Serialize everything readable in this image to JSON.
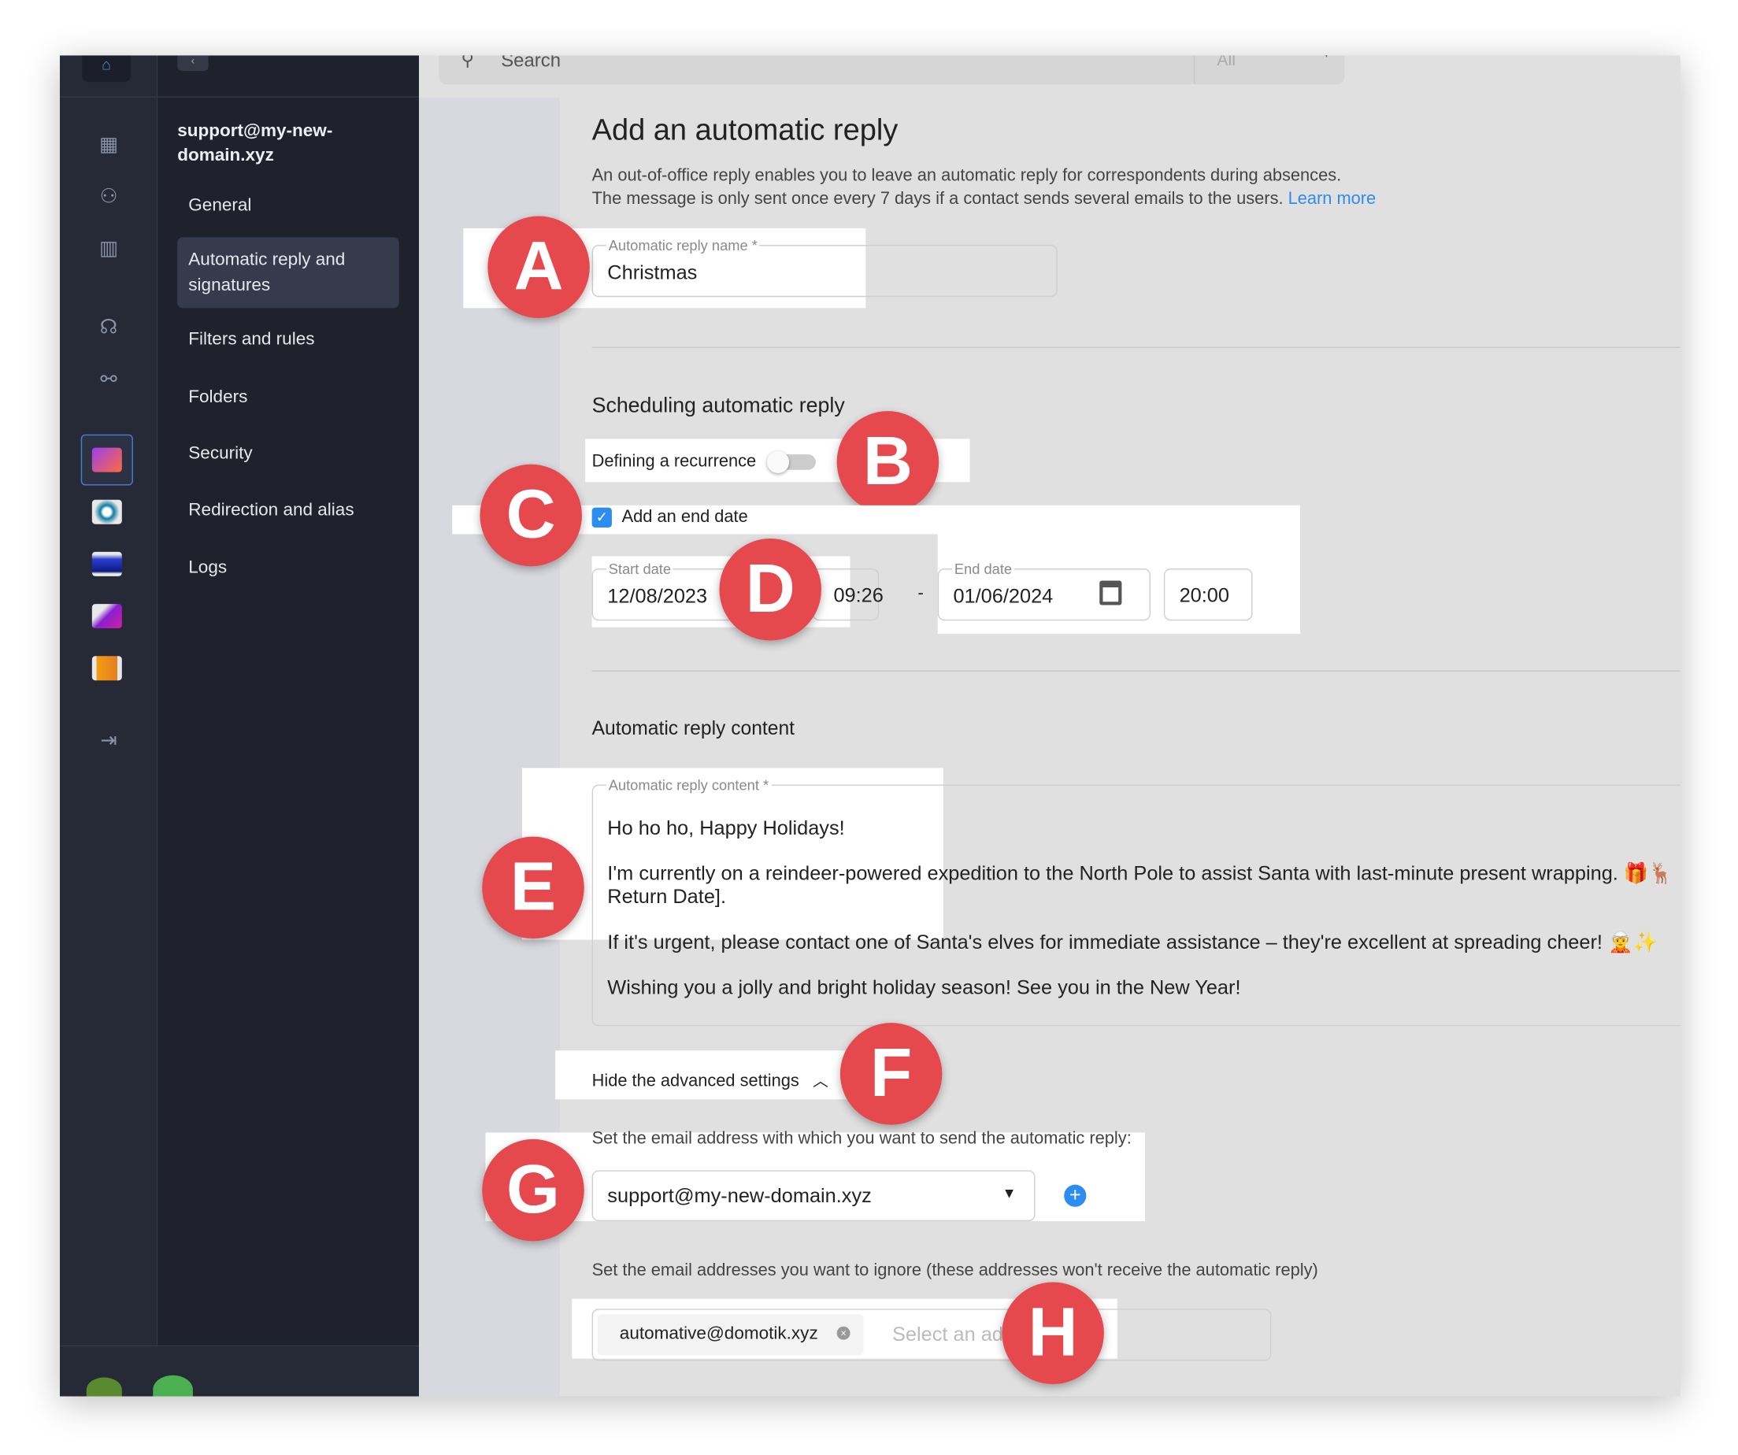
{
  "sidebar": {
    "account": "support@my-new-domain.xyz",
    "items": [
      {
        "label": "General",
        "active": false
      },
      {
        "label": "Automatic reply and signatures",
        "active": true
      },
      {
        "label": "Filters and rules",
        "active": false
      },
      {
        "label": "Folders",
        "active": false
      },
      {
        "label": "Security",
        "active": false
      },
      {
        "label": "Redirection and alias",
        "active": false
      },
      {
        "label": "Logs",
        "active": false
      }
    ],
    "rail_icons": [
      "home-icon",
      "calculator-icon",
      "users-icon",
      "building-icon",
      "headset-icon",
      "handshake-icon",
      "logout-icon"
    ],
    "apps": [
      "kmail-app",
      "kdrive-app",
      "kchat-app",
      "swisstransfer-app",
      "kmeet-app"
    ]
  },
  "search": {
    "placeholder": "Search",
    "filter": "All"
  },
  "page": {
    "title": "Add an automatic reply",
    "desc1": "An out-of-office reply enables you to leave an automatic reply for correspondents during absences.",
    "desc2": "The message is only sent once every 7 days if a contact sends several emails to the users.",
    "learn_more": "Learn more"
  },
  "name_field": {
    "label": "Automatic reply name *",
    "value": "Christmas"
  },
  "scheduling": {
    "title": "Scheduling automatic reply",
    "recurrence_label": "Defining a recurrence",
    "recurrence_on": false,
    "end_date_label": "Add an end date",
    "end_date_checked": true,
    "start_label": "Start date",
    "start_date": "12/08/2023",
    "start_time": "09:26",
    "separator": "-",
    "end_label": "End date",
    "end_date": "01/06/2024",
    "end_time": "20:00"
  },
  "content": {
    "title": "Automatic reply content",
    "label": "Automatic reply content *",
    "lines": [
      "Ho ho ho, Happy Holidays!",
      "I'm currently on a reindeer-powered expedition to the North Pole to assist Santa with last-minute present wrapping. 🎁🦌",
      "Return Date].",
      "If it's urgent, please contact one of Santa's elves for immediate assistance – they're excellent at spreading cheer! 🧝✨",
      "Wishing you a jolly and bright holiday season! See you in the New Year!"
    ]
  },
  "advanced": {
    "toggle_label": "Hide the advanced settings",
    "sender_label": "Set the email address with which you want to send the automatic reply:",
    "sender_value": "support@my-new-domain.xyz",
    "ignore_label": "Set the email addresses you want to ignore (these addresses won't receive the automatic reply)",
    "ignore_chip": "automative@domotik.xyz",
    "ignore_placeholder": "Select an address"
  },
  "annotations": [
    "A",
    "B",
    "C",
    "D",
    "E",
    "F",
    "G",
    "H"
  ],
  "colors": {
    "accent": "#2d8cf0",
    "annotation": "#e5484d",
    "sidebar": "#1f212c"
  }
}
